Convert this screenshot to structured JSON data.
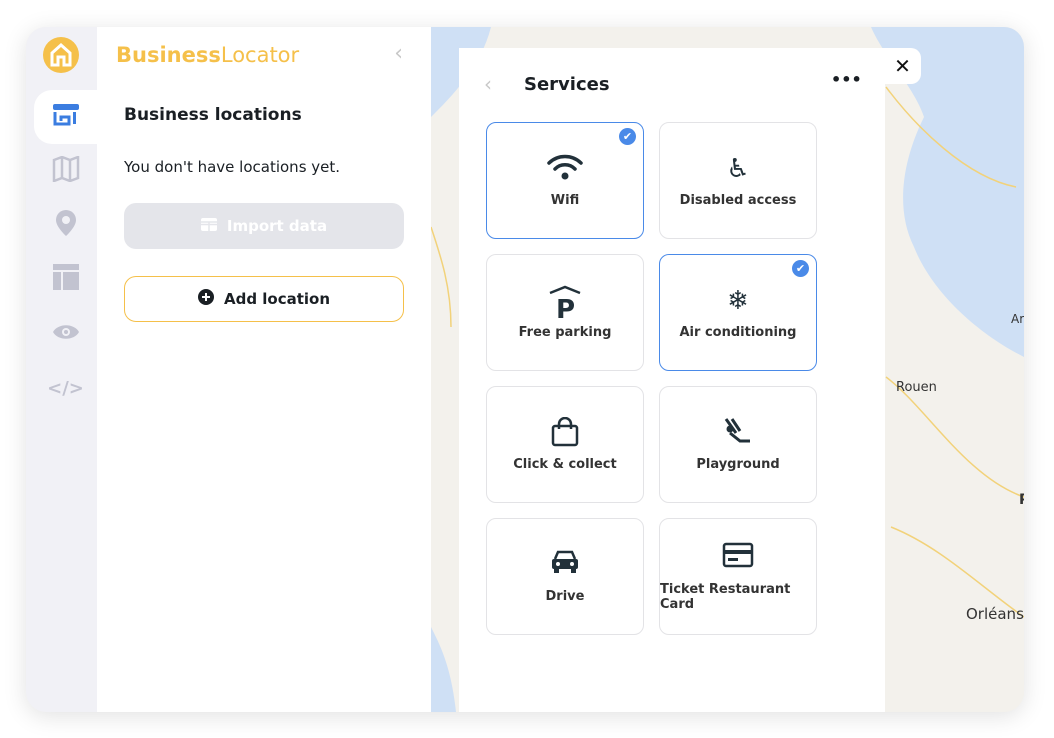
{
  "app": {
    "brand_part1": "Business",
    "brand_part2": "Locator"
  },
  "rail": {
    "items": [
      {
        "icon": "store-icon",
        "active": true
      },
      {
        "icon": "map-icon"
      },
      {
        "icon": "pin-icon"
      },
      {
        "icon": "layout-icon"
      },
      {
        "icon": "eye-icon"
      },
      {
        "icon": "code-icon"
      }
    ]
  },
  "panel": {
    "title": "Business locations",
    "empty_text": "You don't have locations yet.",
    "import_label": "Import data",
    "add_label": "Add location"
  },
  "modal": {
    "title": "Services",
    "close": "✕",
    "services": [
      {
        "label": "Wifi",
        "icon": "wifi-icon",
        "selected": true
      },
      {
        "label": "Disabled access",
        "icon": "wheelchair-icon",
        "selected": false
      },
      {
        "label": "Free parking",
        "icon": "parking-icon",
        "selected": false
      },
      {
        "label": "Air conditioning",
        "icon": "snowflake-icon",
        "selected": true
      },
      {
        "label": "Click & collect",
        "icon": "shopping-bag-icon",
        "selected": false
      },
      {
        "label": "Playground",
        "icon": "swing-icon",
        "selected": false
      },
      {
        "label": "Drive",
        "icon": "car-icon",
        "selected": false
      },
      {
        "label": "Ticket Restaurant Card",
        "icon": "card-icon",
        "selected": false
      }
    ]
  },
  "map": {
    "cities": [
      "Rouen",
      "Orléans",
      "Ar",
      "P"
    ]
  },
  "colors": {
    "brand": "#f5c04a",
    "accent": "#4a8ae8"
  }
}
